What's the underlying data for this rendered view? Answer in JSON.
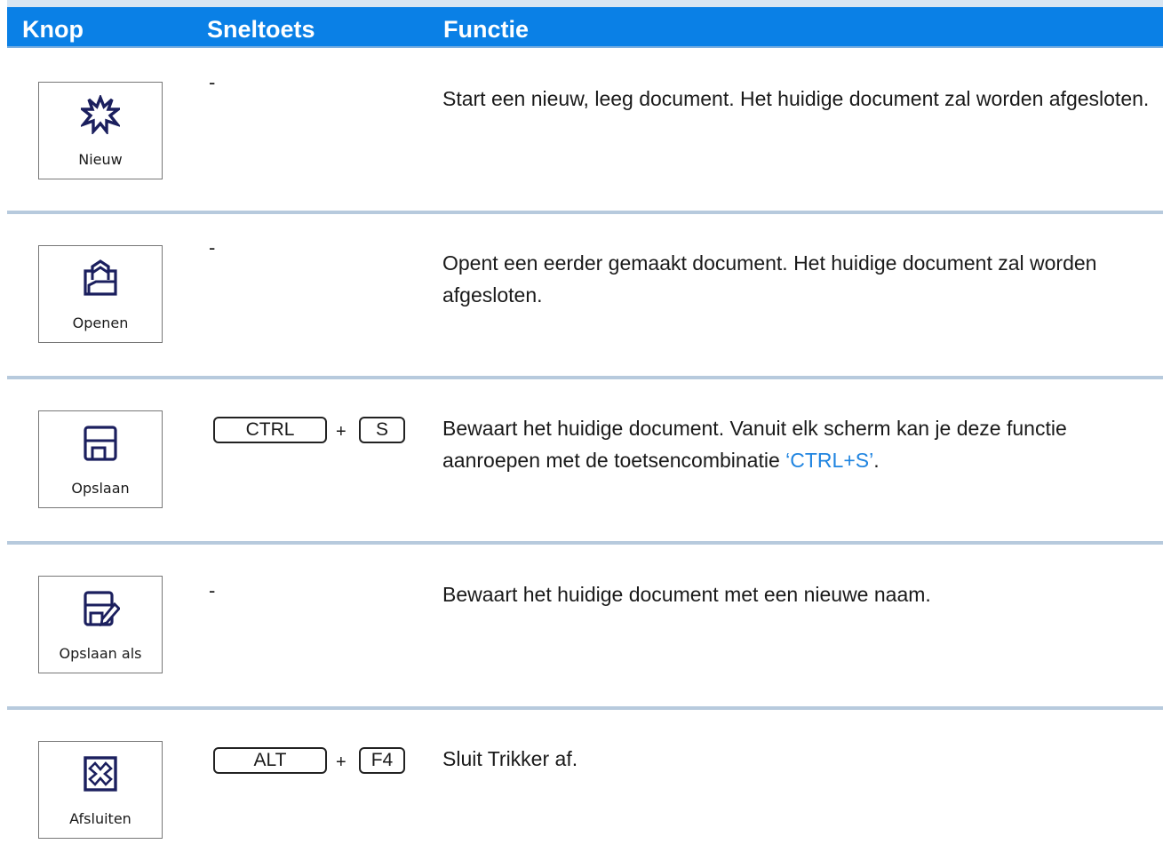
{
  "header": {
    "col_button": "Knop",
    "col_shortcut": "Sneltoets",
    "col_function": "Functie"
  },
  "rows": [
    {
      "button_label": "Nieuw",
      "icon": "star-burst-icon",
      "shortcut": "-",
      "description": "Start een nieuw, leeg document. Het huidige document zal worden afgesloten."
    },
    {
      "button_label": "Openen",
      "icon": "folder-open-icon",
      "shortcut": "-",
      "description": "Opent een eerder gemaakt document. Het huidige document zal worden afgesloten."
    },
    {
      "button_label": "Opslaan",
      "icon": "floppy-disk-icon",
      "shortcut_keys": [
        "CTRL",
        "S"
      ],
      "plus": "+",
      "description_before": "Bewaart het huidige document. Vanuit elk scherm kan je deze functie aanroepen met de toetsencombinatie ",
      "description_link": "‘CTRL+S’",
      "description_after": "."
    },
    {
      "button_label": "Opslaan als",
      "icon": "floppy-disk-pencil-icon",
      "shortcut": "-",
      "description": "Bewaart het huidige document met een nieuwe naam."
    },
    {
      "button_label": "Afsluiten",
      "icon": "close-box-icon",
      "shortcut_keys": [
        "ALT",
        "F4"
      ],
      "plus": "+",
      "description": "Sluit Trikker af."
    }
  ],
  "colors": {
    "header_bg": "#0a80e6",
    "header_text": "#ffffff",
    "divider": "#b7cadd",
    "link": "#1f84e0",
    "icon": "#1b1f5e"
  }
}
